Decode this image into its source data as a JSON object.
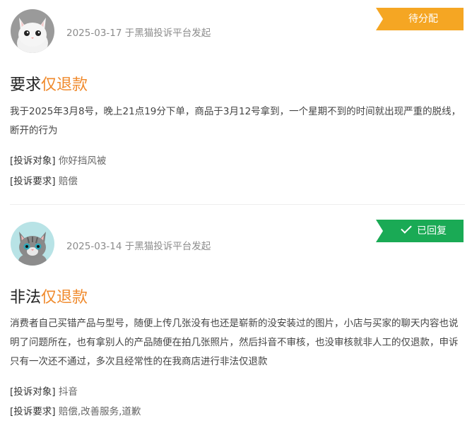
{
  "complaints": [
    {
      "date": "2025-03-17",
      "source": "于黑猫投诉平台发起",
      "status": "待分配",
      "status_color": "#f5a623",
      "title_prefix": "要求",
      "title_highlight": "仅退款",
      "description": "我于2025年3月8号，晚上21点19分下单，商品于3月12号拿到，一个星期不到的时间就出现严重的脱线，断开的行为",
      "target_label": "[投诉对象]",
      "target_value": "你好挡风被",
      "request_label": "[投诉要求]",
      "request_value": "赔偿"
    },
    {
      "date": "2025-03-14",
      "source": "于黑猫投诉平台发起",
      "status": "已回复",
      "status_color": "#1aaa55",
      "title_prefix": "非法",
      "title_highlight": "仅退款",
      "description": "消费者自己买错产品与型号，随便上传几张没有也还是崭新的没安装过的图片，小店与买家的聊天内容也说明了问题所在，也有拿别人的产品随便在拍几张照片，然后抖音不审核，也没审核就非人工的仅退款，申诉只有一次还不通过，多次且经常性的在我商店进行非法仅退款",
      "target_label": "[投诉对象]",
      "target_value": "抖音",
      "request_label": "[投诉要求]",
      "request_value": "赔偿,改善服务,道歉"
    }
  ],
  "colors": {
    "highlight": "#f08a2c",
    "pending": "#f5a623",
    "replied": "#1aaa55"
  }
}
